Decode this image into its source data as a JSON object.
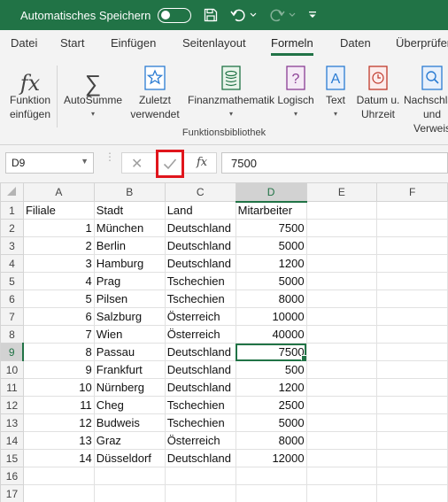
{
  "titlebar": {
    "autosave_label": "Automatisches Speichern",
    "toggle_state": "Aus"
  },
  "tabs": [
    {
      "label": "Datei"
    },
    {
      "label": "Start"
    },
    {
      "label": "Einfügen"
    },
    {
      "label": "Seitenlayout"
    },
    {
      "label": "Formeln",
      "active": true
    },
    {
      "label": "Daten"
    },
    {
      "label": "Überprüfen"
    }
  ],
  "ribbon": {
    "insert_function": "Funktion einfügen",
    "autosum": "AutoSumme",
    "recent": "Zuletzt verwendet",
    "financial": "Finanzmathematik",
    "logical": "Logisch",
    "text": "Text",
    "datetime": "Datum u. Uhrzeit",
    "lookup": "Nachschlagen und Verweis",
    "group_label": "Funktionsbibliothek"
  },
  "formula_bar": {
    "name_box": "D9",
    "fx_label": "fx",
    "value": "7500"
  },
  "sheet": {
    "columns": [
      "A",
      "B",
      "C",
      "D",
      "E",
      "F"
    ],
    "rows": [
      {
        "n": "1",
        "a": "Filiale",
        "b": "Stadt",
        "c": "Land",
        "d": "Mitarbeiter"
      },
      {
        "n": "2",
        "a": "1",
        "b": "München",
        "c": "Deutschland",
        "d": "7500"
      },
      {
        "n": "3",
        "a": "2",
        "b": "Berlin",
        "c": "Deutschland",
        "d": "5000"
      },
      {
        "n": "4",
        "a": "3",
        "b": "Hamburg",
        "c": "Deutschland",
        "d": "1200"
      },
      {
        "n": "5",
        "a": "4",
        "b": "Prag",
        "c": "Tschechien",
        "d": "5000"
      },
      {
        "n": "6",
        "a": "5",
        "b": "Pilsen",
        "c": "Tschechien",
        "d": "8000"
      },
      {
        "n": "7",
        "a": "6",
        "b": "Salzburg",
        "c": "Österreich",
        "d": "10000"
      },
      {
        "n": "8",
        "a": "7",
        "b": "Wien",
        "c": "Österreich",
        "d": "40000"
      },
      {
        "n": "9",
        "a": "8",
        "b": "Passau",
        "c": "Deutschland",
        "d": "7500"
      },
      {
        "n": "10",
        "a": "9",
        "b": "Frankfurt",
        "c": "Deutschland",
        "d": "500"
      },
      {
        "n": "11",
        "a": "10",
        "b": "Nürnberg",
        "c": "Deutschland",
        "d": "1200"
      },
      {
        "n": "12",
        "a": "11",
        "b": "Cheg",
        "c": "Tschechien",
        "d": "2500"
      },
      {
        "n": "13",
        "a": "12",
        "b": "Budweis",
        "c": "Tschechien",
        "d": "5000"
      },
      {
        "n": "14",
        "a": "13",
        "b": "Graz",
        "c": "Österreich",
        "d": "8000"
      },
      {
        "n": "15",
        "a": "14",
        "b": "Düsseldorf",
        "c": "Deutschland",
        "d": "12000"
      },
      {
        "n": "16",
        "a": "",
        "b": "",
        "c": "",
        "d": ""
      },
      {
        "n": "17",
        "a": "",
        "b": "",
        "c": "",
        "d": ""
      }
    ],
    "active_cell": "D9"
  },
  "colors": {
    "accent": "#217346",
    "highlight": "#e0151c"
  }
}
